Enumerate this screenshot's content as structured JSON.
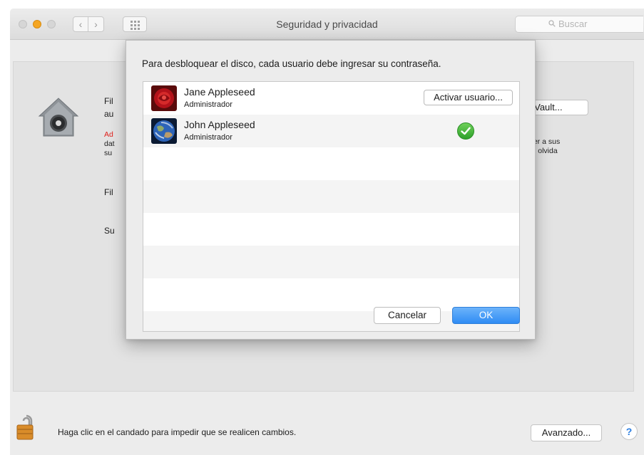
{
  "window": {
    "title": "Seguridad y privacidad",
    "search_placeholder": "Buscar"
  },
  "background": {
    "fragment_fi1": "Fil",
    "fragment_au": "au",
    "fragment_ad": "Ad",
    "fragment_dat": "dat",
    "fragment_su": "su",
    "fragment_fi2": "Fil",
    "fragment_su2": "Su",
    "filevault_button": "leVault...",
    "right_line1": "der a sus",
    "right_line2": "Si olvida"
  },
  "dialog": {
    "prompt": "Para desbloquear el disco, cada usuario debe ingresar su contraseña.",
    "users": [
      {
        "name": "Jane Appleseed",
        "role": "Administrador",
        "action": "Activar usuario..."
      },
      {
        "name": "John Appleseed",
        "role": "Administrador",
        "status": "enabled"
      }
    ],
    "cancel": "Cancelar",
    "ok": "OK"
  },
  "bottom": {
    "lock_text": "Haga clic en el candado para impedir que se realicen cambios.",
    "advanced": "Avanzado...",
    "help": "?"
  },
  "colors": {
    "accent": "#2f8cf4",
    "warning_red": "#e0201b",
    "check_green": "#2ea12a"
  },
  "icons": [
    "back-icon",
    "forward-icon",
    "grid-icon",
    "search-icon",
    "house-lock-icon",
    "padlock-icon",
    "checkmark-icon"
  ]
}
